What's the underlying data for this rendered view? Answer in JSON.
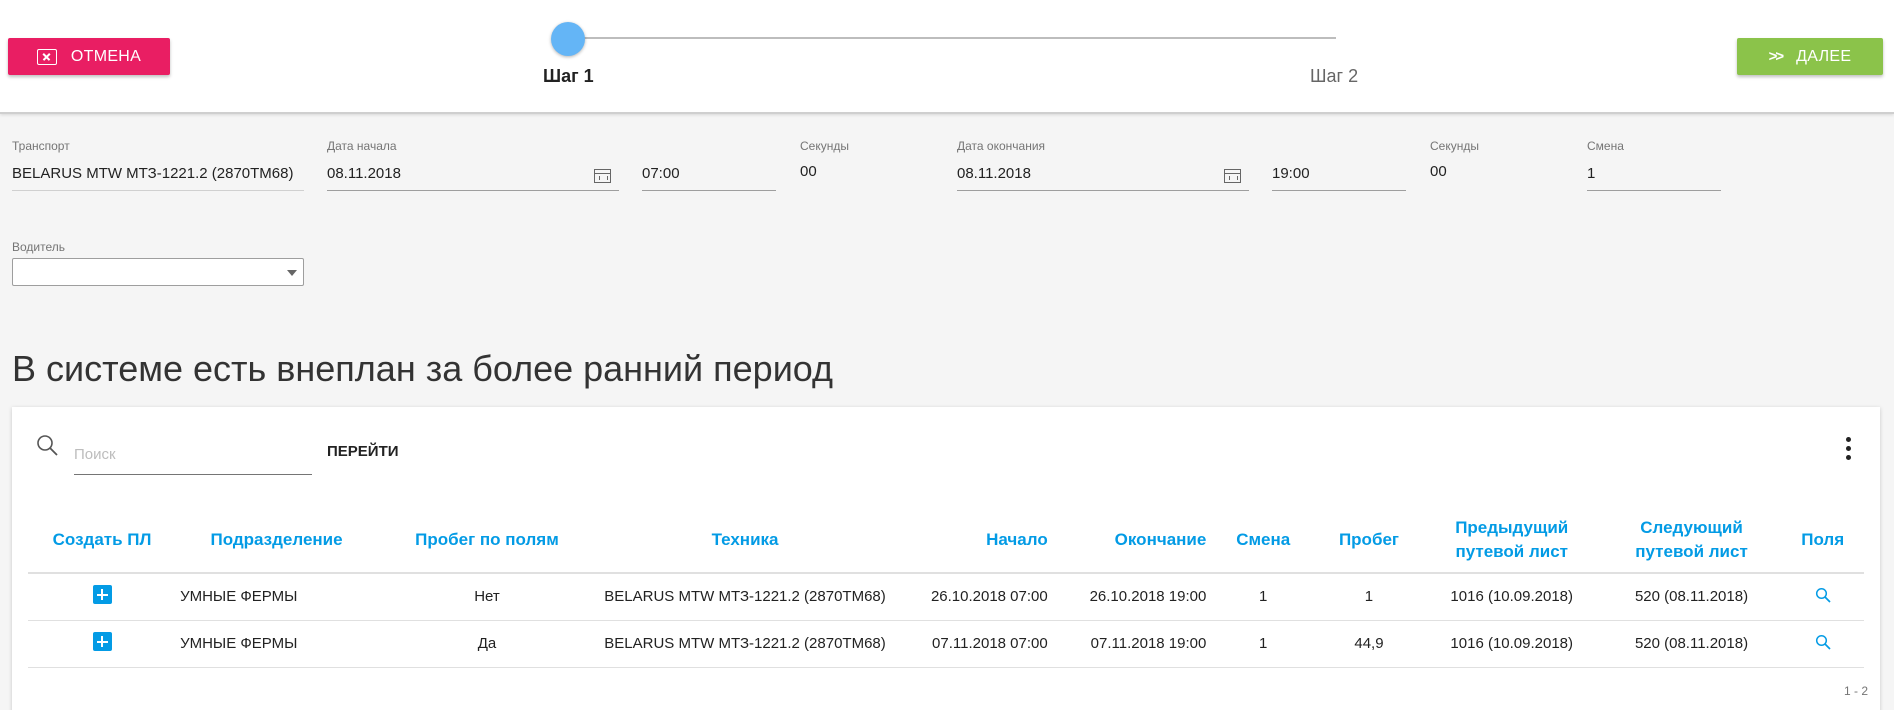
{
  "toolbar": {
    "cancel_label": "ОТМЕНА",
    "cancel_color": "#e91e63",
    "next_label": "ДАЛЕЕ",
    "next_color": "#8bc34a"
  },
  "stepper": {
    "steps": [
      {
        "label": "Шаг 1",
        "active": true
      },
      {
        "label": "Шаг 2",
        "active": false
      }
    ],
    "active_color": "#64b5f6"
  },
  "form": {
    "transport": {
      "label": "Транспорт",
      "value": "BELARUS MTW МТЗ-1221.2 (2870ТМ68)"
    },
    "start_date": {
      "label": "Дата начала",
      "value": "08.11.2018",
      "time": "07:00"
    },
    "start_seconds": {
      "label": "Секунды",
      "value": "00"
    },
    "end_date": {
      "label": "Дата окончания",
      "value": "08.11.2018",
      "time": "19:00"
    },
    "end_seconds": {
      "label": "Секунды",
      "value": "00"
    },
    "shift": {
      "label": "Смена",
      "value": "1"
    },
    "driver": {
      "label": "Водитель",
      "value": ""
    }
  },
  "section_title": "В системе есть внеплан за более ранний период",
  "grid": {
    "search_placeholder": "Поиск",
    "go_label": "ПЕРЕЙТИ",
    "header_color": "#039be5",
    "columns": [
      {
        "line1": "",
        "line2": "Создать ПЛ"
      },
      {
        "line1": "",
        "line2": "Подразделение"
      },
      {
        "line1": "",
        "line2": "Пробег по полям"
      },
      {
        "line1": "",
        "line2": "Техника"
      },
      {
        "line1": "",
        "line2": "Начало"
      },
      {
        "line1": "",
        "line2": "Окончание"
      },
      {
        "line1": "",
        "line2": "Смена"
      },
      {
        "line1": "",
        "line2": "Пробег"
      },
      {
        "line1": "Предыдущий",
        "line2": "путевой лист"
      },
      {
        "line1": "Следующий",
        "line2": "путевой лист"
      },
      {
        "line1": "",
        "line2": "Поля"
      }
    ],
    "rows": [
      {
        "department": "УМНЫЕ ФЕРМЫ",
        "field_mileage": "Нет",
        "vehicle": "BELARUS MTW МТЗ-1221.2 (2870ТМ68)",
        "start": "26.10.2018 07:00",
        "end": "26.10.2018 19:00",
        "shift": "1",
        "mileage": "1",
        "prev_waybill": "1016 (10.09.2018)",
        "next_waybill": "520 (08.11.2018)"
      },
      {
        "department": "УМНЫЕ ФЕРМЫ",
        "field_mileage": "Да",
        "vehicle": "BELARUS MTW МТЗ-1221.2 (2870ТМ68)",
        "start": "07.11.2018 07:00",
        "end": "07.11.2018 19:00",
        "shift": "1",
        "mileage": "44,9",
        "prev_waybill": "1016 (10.09.2018)",
        "next_waybill": "520 (08.11.2018)"
      }
    ],
    "pager": "1 - 2"
  }
}
